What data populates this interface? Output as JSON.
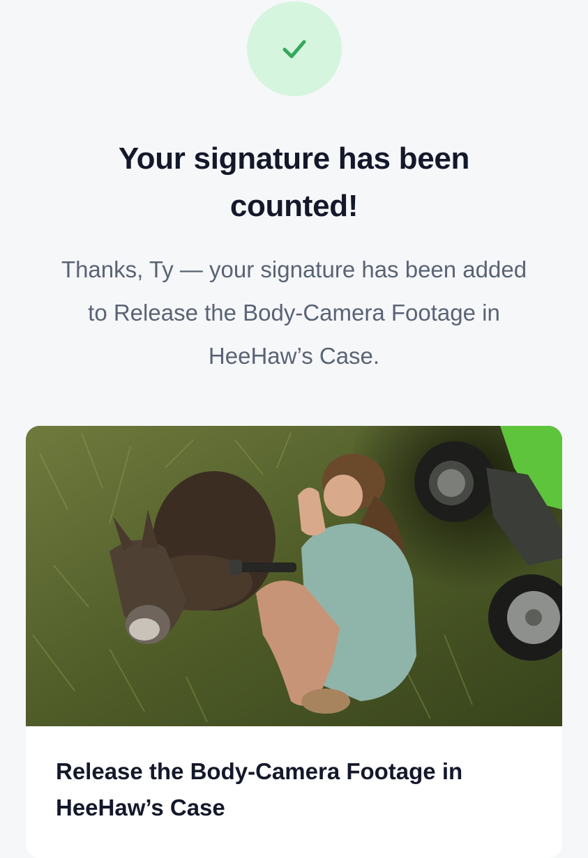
{
  "status": {
    "icon": "checkmark-icon",
    "accent_color": "#34a85a",
    "circle_color": "#d6f5df"
  },
  "confirmation": {
    "title": "Your signature has been counted!",
    "message": "Thanks, Ty — your signature has been added to Release the Body-Camera Footage in HeeHaw’s Case."
  },
  "petition_card": {
    "title": "Release the Body-Camera Footage in HeeHaw’s Case"
  }
}
